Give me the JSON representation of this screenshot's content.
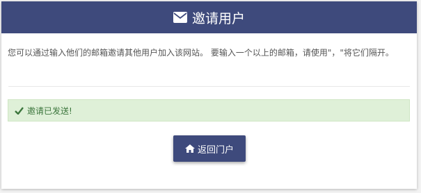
{
  "header": {
    "title": "邀请用户",
    "icon": "envelope-icon"
  },
  "description": "您可以通过输入他们的邮箱邀请其他用户加入该网站。 要输入一个以上的邮箱，请使用\"，\"将它们隔开。",
  "alert": {
    "text": "邀请已发送!",
    "icon": "check-icon",
    "color": "#3c763d",
    "background": "#dff0d8"
  },
  "actions": {
    "back_label": "返回门户",
    "back_icon": "home-icon"
  },
  "colors": {
    "brand": "#3e4a7c"
  }
}
